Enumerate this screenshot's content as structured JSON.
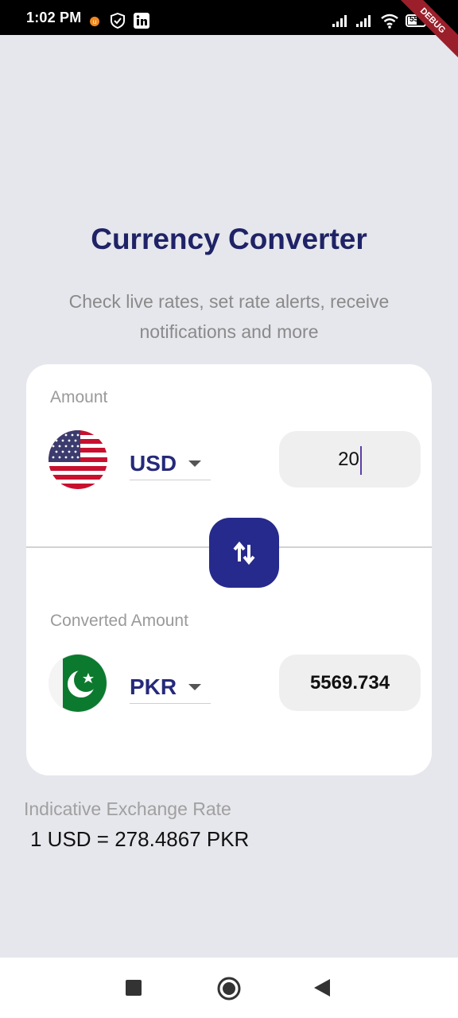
{
  "status_bar": {
    "time": "1:02 PM",
    "icons": [
      "notification-dot-icon",
      "shield-icon",
      "linkedin-icon",
      "signal-icon",
      "signal-icon",
      "wifi-icon",
      "battery-icon"
    ],
    "battery_level": "55",
    "debug_ribbon": "DEBUG"
  },
  "header": {
    "title": "Currency Converter",
    "subtitle": "Check live rates, set rate alerts, receive notifications and more"
  },
  "from": {
    "label": "Amount",
    "currency": "USD",
    "flag": "us-flag-icon",
    "amount": "20"
  },
  "to": {
    "label": "Converted Amount",
    "currency": "PKR",
    "flag": "pk-flag-icon",
    "amount": "5569.734"
  },
  "rate": {
    "label": "Indicative Exchange Rate",
    "value": "1 USD = 278.4867 PKR"
  },
  "colors": {
    "accent": "#262a8c",
    "title": "#1f2366",
    "background": "#e6e7ec"
  }
}
